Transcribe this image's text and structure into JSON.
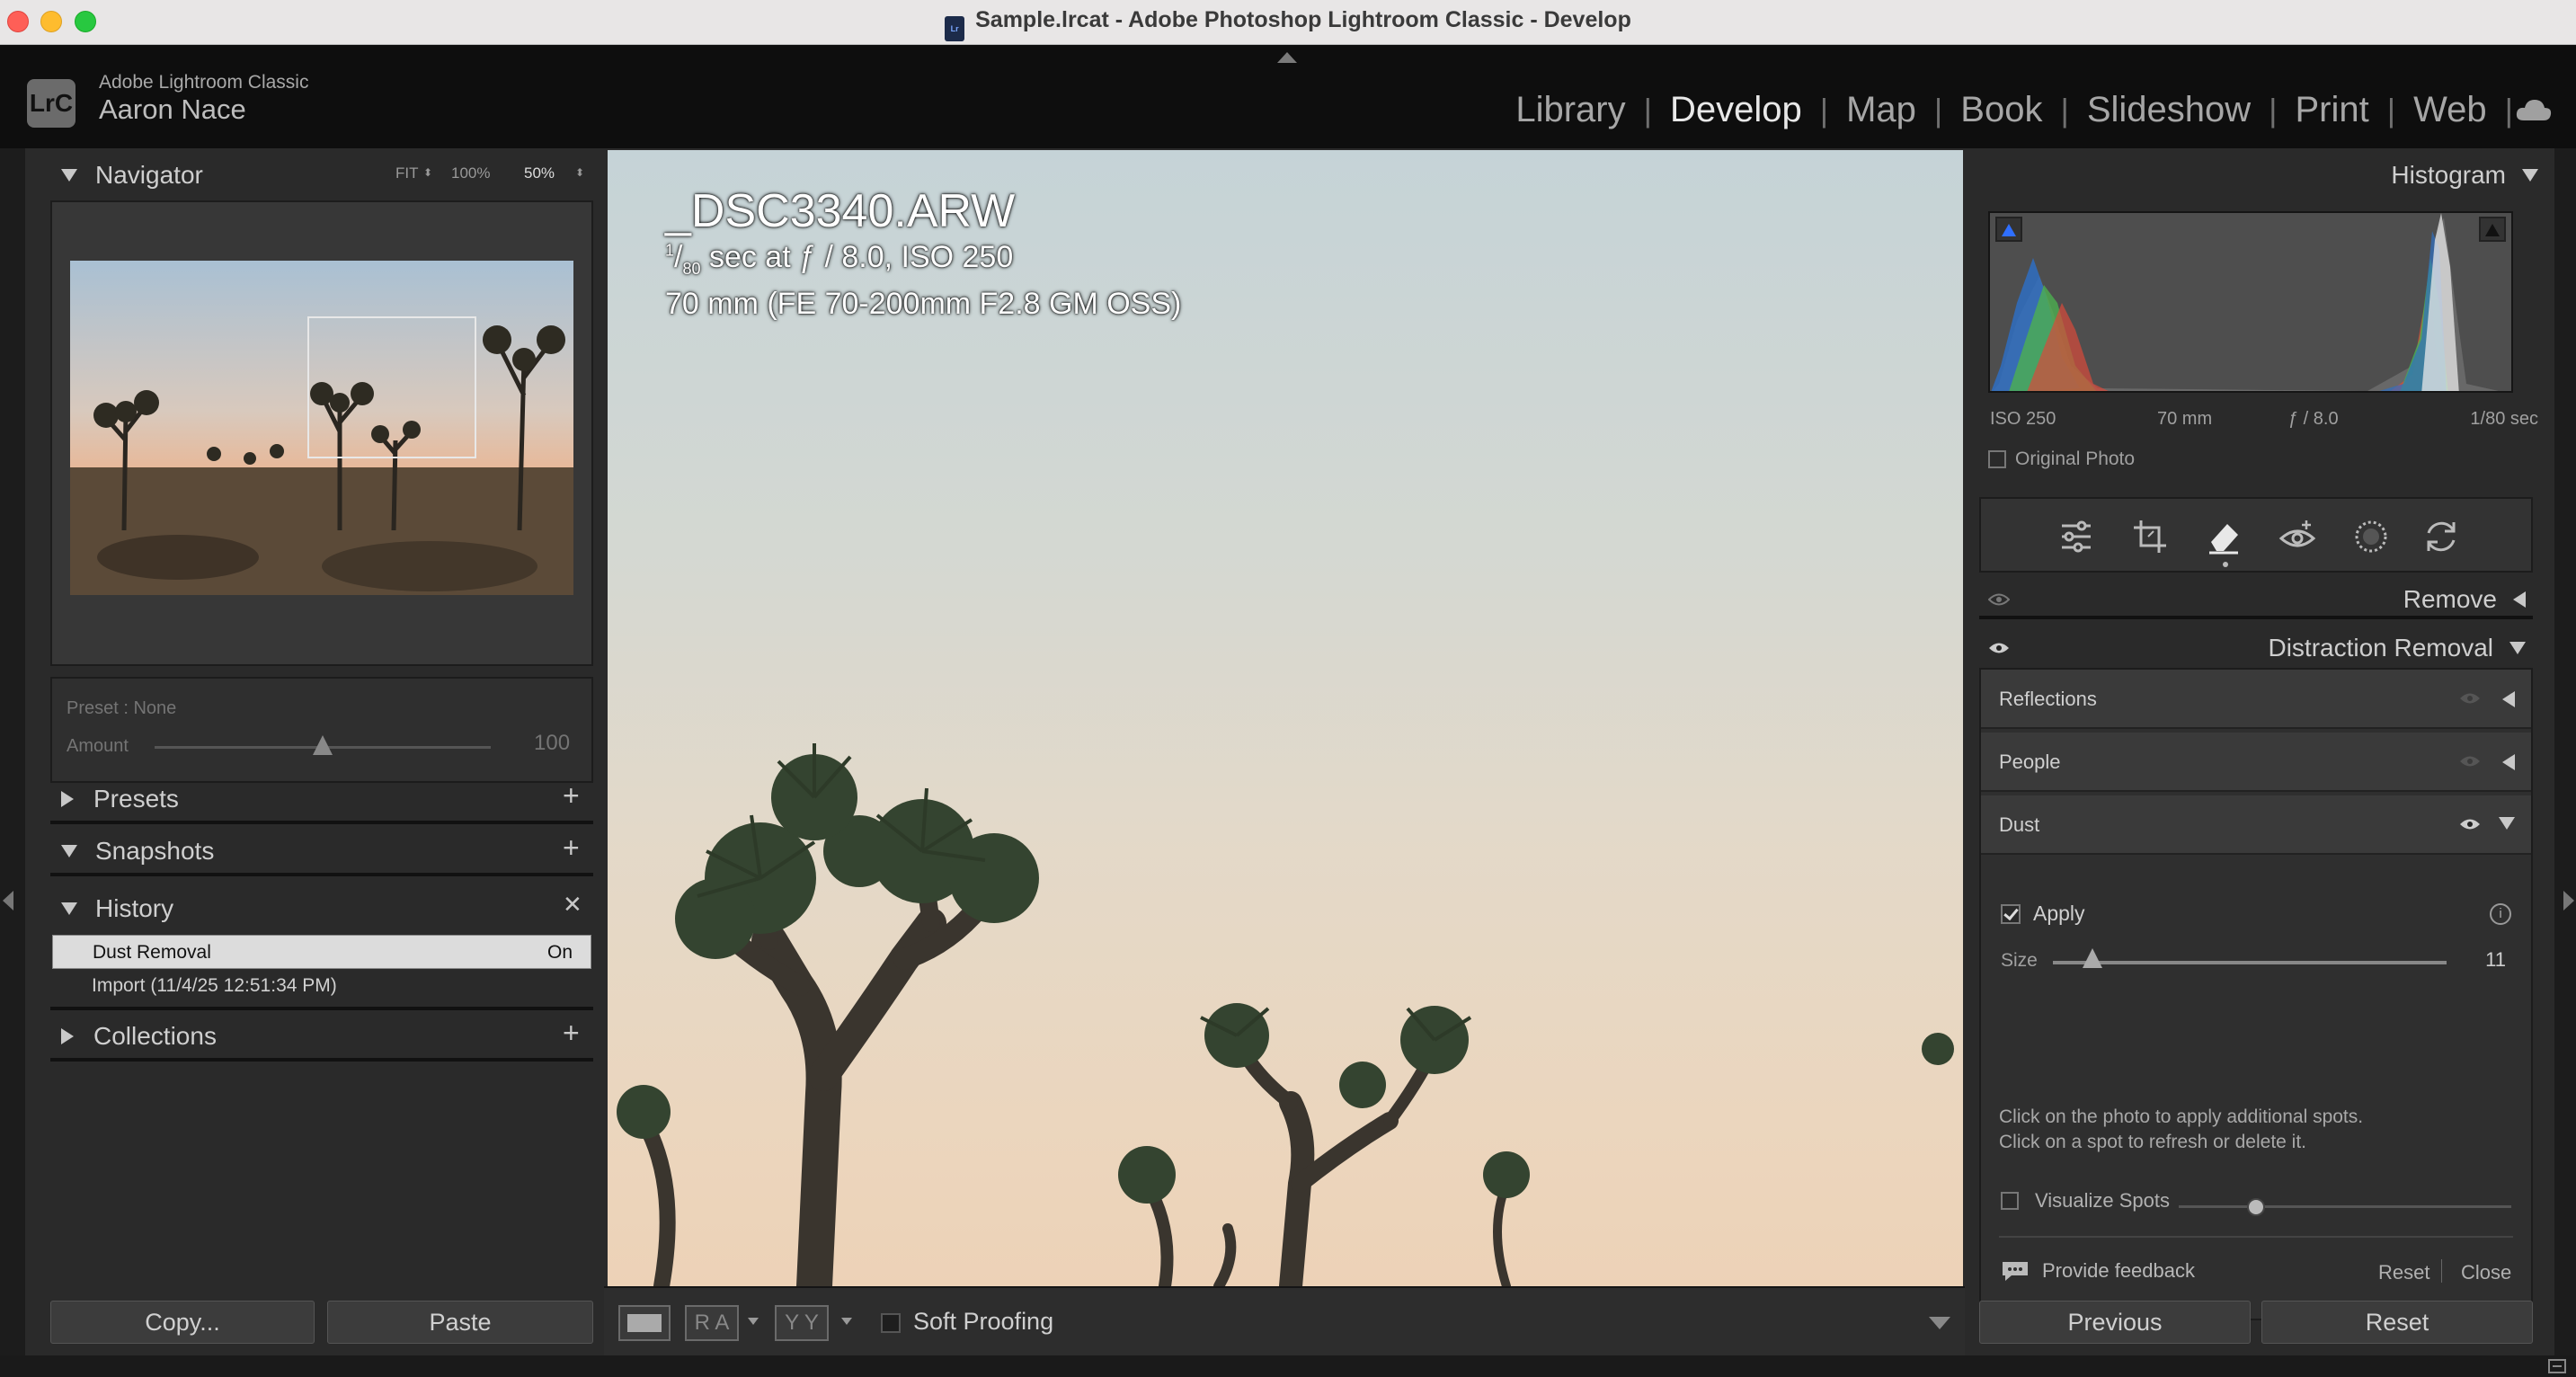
{
  "window": {
    "title": "Sample.lrcat - Adobe Photoshop Lightroom Classic - Develop",
    "doc_icon_text": "Lr"
  },
  "identity": {
    "logo": "LrC",
    "app_name": "Adobe Lightroom Classic",
    "user_name": "Aaron Nace"
  },
  "modules": [
    "Library",
    "Develop",
    "Map",
    "Book",
    "Slideshow",
    "Print",
    "Web"
  ],
  "active_module": "Develop",
  "navigator": {
    "title": "Navigator",
    "zoom_fit": "FIT",
    "zoom_100": "100%",
    "zoom_50": "50%"
  },
  "preset": {
    "label": "Preset : None",
    "amount_label": "Amount",
    "amount_value": "100"
  },
  "panels": {
    "presets": "Presets",
    "snapshots": "Snapshots",
    "history": "History",
    "collections": "Collections"
  },
  "history": [
    {
      "label": "Dust Removal",
      "state": "On",
      "selected": true
    },
    {
      "label": "Import (11/4/25 12:51:34 PM)",
      "state": "",
      "selected": false
    }
  ],
  "left_buttons": {
    "copy": "Copy...",
    "paste": "Paste"
  },
  "image_overlay": {
    "filename": "_DSC3340.ARW",
    "exposure_num": "1",
    "exposure_den": "80",
    "exposure_rest": " sec at ƒ / 8.0, ISO 250",
    "lens": "70 mm (FE 70-200mm F2.8 GM OSS)"
  },
  "toolbar": {
    "soft_proofing": "Soft Proofing",
    "view_ra": "R A",
    "view_yy": "Y Y"
  },
  "histogram": {
    "title": "Histogram",
    "iso": "ISO 250",
    "focal": "70 mm",
    "aperture": "ƒ / 8.0",
    "shutter": "1/80 sec",
    "original_photo": "Original Photo"
  },
  "tools": [
    "sliders-icon",
    "crop-icon",
    "eraser-icon",
    "redeye-icon",
    "mask-icon",
    "sync-icon"
  ],
  "remove": {
    "title": "Remove"
  },
  "distraction": {
    "title": "Distraction Removal",
    "reflections": "Reflections",
    "people": "People",
    "dust": "Dust",
    "apply": "Apply",
    "size_label": "Size",
    "size_value": "11",
    "size_fraction": 0.1,
    "hint1": "Click on the photo to apply additional spots.",
    "hint2": "Click on a spot to refresh or delete it.",
    "visualize": "Visualize Spots",
    "feedback": "Provide feedback",
    "reset": "Reset",
    "close": "Close"
  },
  "right_buttons": {
    "previous": "Previous",
    "reset": "Reset"
  }
}
